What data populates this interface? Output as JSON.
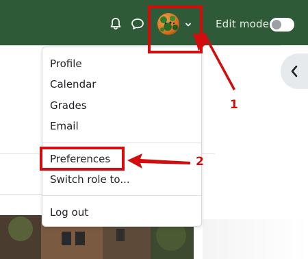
{
  "header": {
    "edit_mode_label": "Edit mode",
    "edit_mode_on": false,
    "icons": [
      "bell-icon",
      "chat-icon",
      "chevron-down-icon"
    ],
    "brand_color": "#2f5a37"
  },
  "user_menu": {
    "items": [
      {
        "label": "Profile"
      },
      {
        "label": "Calendar"
      },
      {
        "label": "Grades"
      },
      {
        "label": "Email"
      },
      {
        "label": "Preferences"
      },
      {
        "label": "Switch role to..."
      },
      {
        "label": "Log out"
      }
    ]
  },
  "annotations": {
    "step_1": "1",
    "step_2": "2",
    "color": "#d10d0d"
  }
}
